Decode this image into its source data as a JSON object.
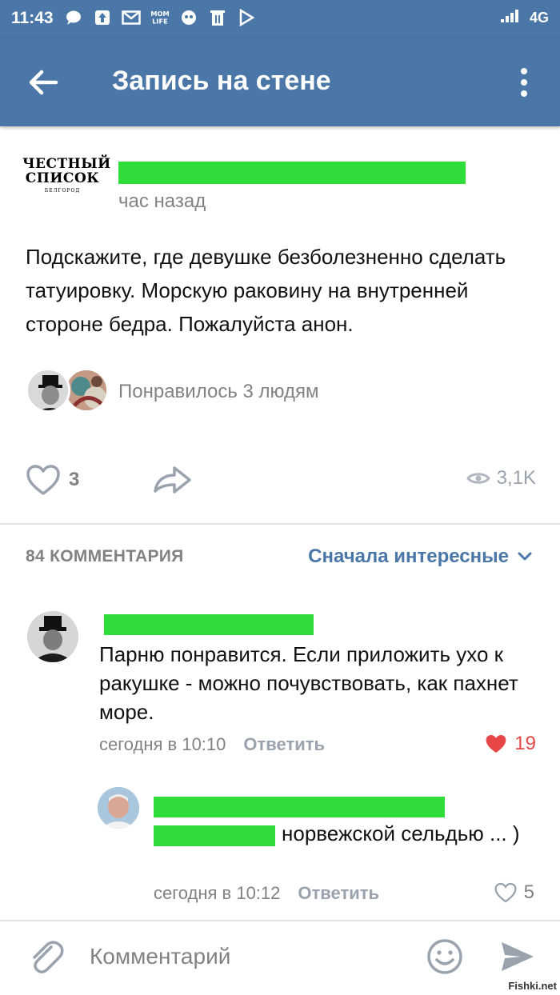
{
  "status_bar": {
    "time": "11:43",
    "network": "4G",
    "icons": [
      "chat-bubble-icon",
      "upload-icon",
      "mail-icon",
      "mom-life-icon",
      "bot-icon",
      "trash-icon",
      "play-store-icon"
    ]
  },
  "app_bar": {
    "title": "Запись на стене",
    "back_icon": "arrow-left-icon",
    "more_icon": "more-vertical-icon"
  },
  "post": {
    "group_logo": {
      "line1": "ЧЕСТНЫЙ",
      "line2": "СПИСОК",
      "line3": "БЕЛГОРОД"
    },
    "time": "час назад",
    "text": "Подскажите, где девушке безболезненно сделать татуировку. Морскую раковину на внутренней стороне бедра. Пожалуйста анон.",
    "liked_by_text": "Понравилось 3 людям",
    "likes": "3",
    "views": "3,1K"
  },
  "comments_section": {
    "count_label": "84 КОММЕНТАРИЯ",
    "sort_label": "Сначала интересные",
    "comments": [
      {
        "text": "Парню понравится. Если приложить ухо к ракушке - можно почувствовать, как пахнет море.",
        "time": "сегодня в 10:10",
        "reply_label": "Ответить",
        "likes": "19",
        "liked": true
      },
      {
        "text": "норвежской сельдью ... )",
        "time": "сегодня в 10:12",
        "reply_label": "Ответить",
        "likes": "5",
        "liked": false
      }
    ]
  },
  "composer": {
    "placeholder": "Комментарий"
  },
  "watermark": "Fishki.net",
  "colors": {
    "brand": "#4a76a8",
    "redaction": "#2fdc3a",
    "like_red": "#e64646",
    "muted": "#828282"
  }
}
